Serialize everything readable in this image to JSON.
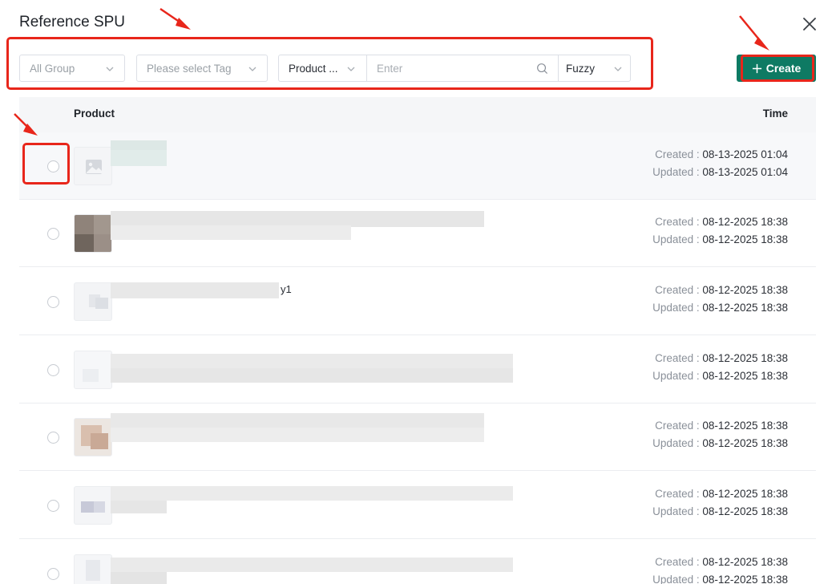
{
  "dialog": {
    "title": "Reference SPU",
    "close_icon": "close-icon"
  },
  "filters": {
    "group_placeholder": "All Group",
    "tag_placeholder": "Please select Tag",
    "search_field": "Product ...",
    "search_placeholder": "Enter",
    "match_mode": "Fuzzy"
  },
  "create": {
    "label": "Create",
    "icon": "plus-icon"
  },
  "table": {
    "columns": {
      "product": "Product",
      "time": "Time"
    },
    "created_label": "Created : ",
    "updated_label": "Updated : ",
    "rows": [
      {
        "created": "08-13-2025 01:04",
        "updated": "08-13-2025 01:04",
        "selected": true,
        "extra": ""
      },
      {
        "created": "08-12-2025 18:38",
        "updated": "08-12-2025 18:38",
        "selected": false,
        "extra": ""
      },
      {
        "created": "08-12-2025 18:38",
        "updated": "08-12-2025 18:38",
        "selected": false,
        "extra": "y1"
      },
      {
        "created": "08-12-2025 18:38",
        "updated": "08-12-2025 18:38",
        "selected": false,
        "extra": ""
      },
      {
        "created": "08-12-2025 18:38",
        "updated": "08-12-2025 18:38",
        "selected": false,
        "extra": ""
      },
      {
        "created": "08-12-2025 18:38",
        "updated": "08-12-2025 18:38",
        "selected": false,
        "extra": ""
      },
      {
        "created": "08-12-2025 18:38",
        "updated": "08-12-2025 18:38",
        "selected": false,
        "extra": ""
      }
    ]
  },
  "colors": {
    "accent": "#0e7a63",
    "annotation": "#e8261b",
    "header_bg": "#f5f6f8"
  }
}
